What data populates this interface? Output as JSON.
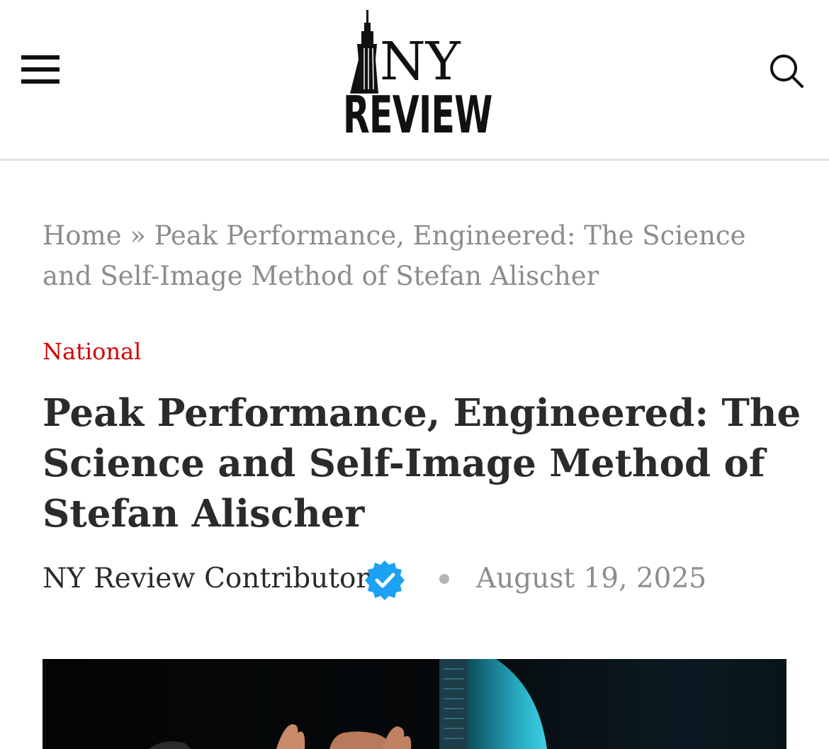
{
  "header": {
    "logo": {
      "line1": "NY",
      "line2": "REVIEW"
    },
    "menu_icon": "hamburger-menu-icon",
    "search_icon": "search-icon"
  },
  "breadcrumb": {
    "home": "Home",
    "separator": "»",
    "current": "Peak Performance, Engineered: The Science and Self-Image Method of Stefan Alischer"
  },
  "article": {
    "category": "National",
    "title": "Peak Performance, Engineered: The Science and Self-Image Method of Stefan Alischer",
    "author": "NY Review Contributor",
    "verified_icon": "verified-badge-icon",
    "date": "August 19, 2025"
  },
  "colors": {
    "category": "#d40000",
    "verified": "#1da1f2",
    "muted_text": "#8c8c8c",
    "body_text": "#2b2b2b"
  }
}
